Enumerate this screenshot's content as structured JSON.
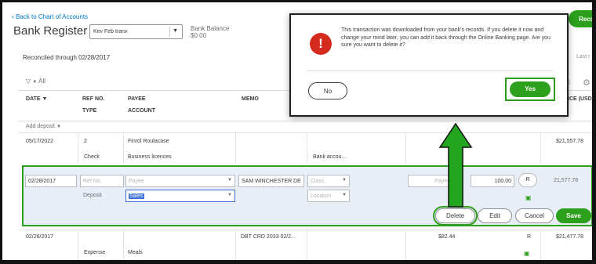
{
  "header": {
    "back_link": "Back to Chart of Accounts",
    "title": "Bank Register",
    "account_value": "Kev Feb tranx",
    "bank_balance_label": "Bank Balance",
    "bank_balance_value": "$0.00",
    "reconciled": "Reconciled through 02/28/2017",
    "top_right_button": "Reco",
    "last_text": "Last r",
    "filter_label": "All"
  },
  "columns": {
    "date": "DATE ▼",
    "ref_no": "REF NO.",
    "type": "TYPE",
    "payee": "PAYEE",
    "account": "ACCOUNT",
    "memo": "MEMO",
    "balance": "ICE (USD)"
  },
  "add_deposit": "Add deposit",
  "rows": [
    {
      "date": "05/17/2022",
      "ref_no": "2",
      "type": "Check",
      "payee": "Finrol Roulacase",
      "account": "Business licences",
      "memo_second": "Bank accou...",
      "balance": "$21,557.78"
    },
    {
      "date": "02/26/2017",
      "ref_no": "",
      "type": "Expense",
      "payee": "",
      "account": "Meals",
      "memo": "DBT CRD 2033 02/2...",
      "payment": "$82.44",
      "status": "R",
      "balance": "$21,477.78"
    }
  ],
  "edit_row": {
    "date": "02/28/2017",
    "ref_placeholder": "Ref No.",
    "payee_placeholder": "Payee",
    "memo": "SAM WINCHESTER DE",
    "class_placeholder": "Class",
    "payment_placeholder": "Paym",
    "deposit": "100.00",
    "status": "R",
    "balance": "21,577.78",
    "type": "Deposit",
    "account": "Sales",
    "location_placeholder": "Location",
    "delete_label": "Delete",
    "edit_label": "Edit",
    "cancel_label": "Cancel",
    "save_label": "Save"
  },
  "dialog": {
    "message": "This transaction was downloaded from your bank's records. If you delete it now and change your mind later, you can add it back through the Online Banking page. Are you sure you want to delete it?",
    "no_label": "No",
    "yes_label": "Yes"
  },
  "colors": {
    "accent_green": "#2ca01c",
    "error_red": "#d52b1e",
    "link_blue": "#0077c5"
  }
}
